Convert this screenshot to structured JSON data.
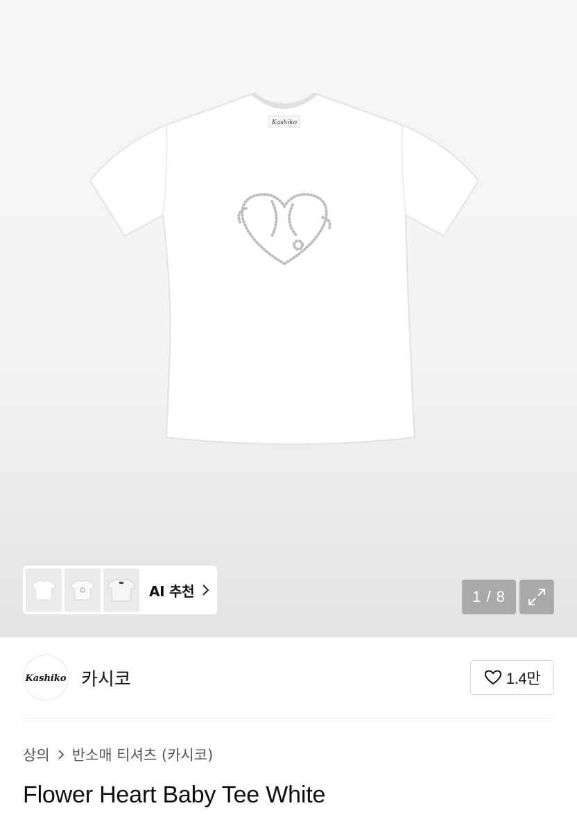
{
  "gallery": {
    "thumbnails": [
      {
        "icon": "tshirt-front-thumbnail"
      },
      {
        "icon": "tshirt-model-thumbnail"
      },
      {
        "icon": "tshirt-detail-thumbnail"
      }
    ],
    "ai_recommend_label": "AI 추천",
    "counter": "1 / 8",
    "expand_icon": "expand-icon"
  },
  "product_image": {
    "tag_text": "Kashiko"
  },
  "brand": {
    "logo_text": "Kashiko",
    "name": "카시코",
    "like_count": "1.4만",
    "like_icon": "heart-icon"
  },
  "breadcrumb": {
    "items": [
      "상의",
      "반소매 티셔츠 (카시코)"
    ]
  },
  "product": {
    "title": "Flower Heart Baby Tee White"
  },
  "colors": {
    "accent_dark": "#111111",
    "counter_bg": "#8a8a8a",
    "hero_bg": "#f4f4f4"
  }
}
